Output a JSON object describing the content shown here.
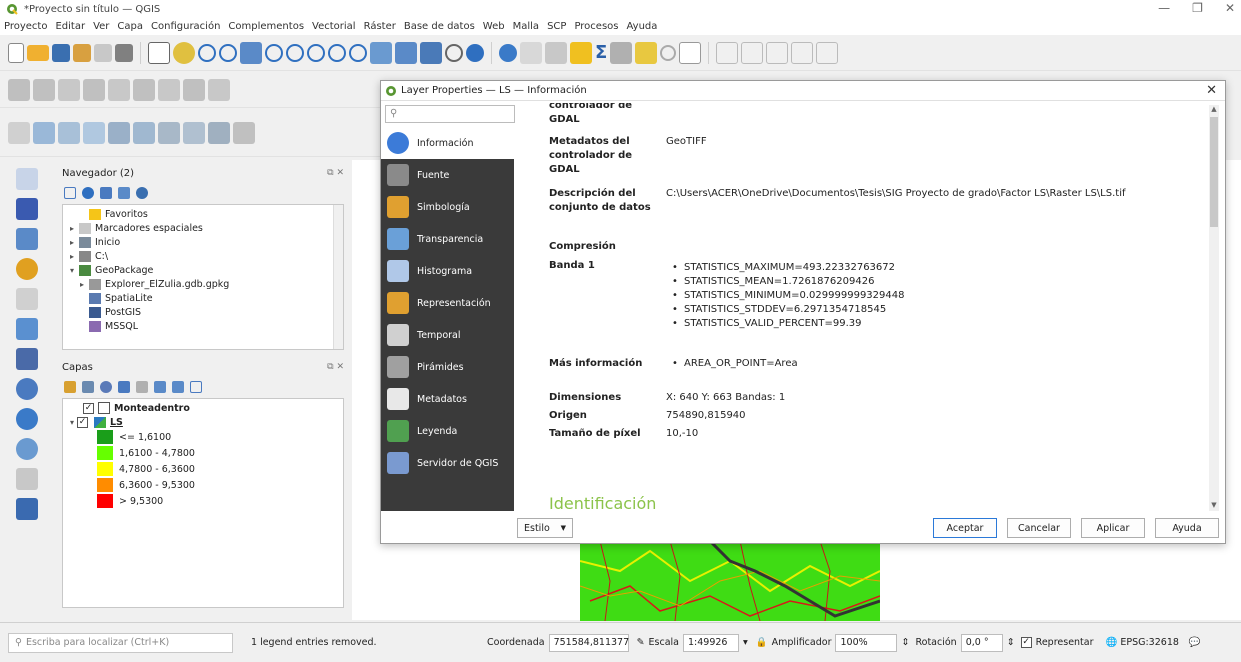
{
  "window": {
    "title": "*Proyecto sin título — QGIS",
    "minimize": "—",
    "maximize": "❐",
    "close": "✕"
  },
  "menu": [
    "Proyecto",
    "Editar",
    "Ver",
    "Capa",
    "Configuración",
    "Complementos",
    "Vectorial",
    "Ráster",
    "Base de datos",
    "Web",
    "Malla",
    "SCP",
    "Procesos",
    "Ayuda"
  ],
  "navigator": {
    "title": "Navegador (2)",
    "items": [
      {
        "label": "Favoritos",
        "icon": "star-icon",
        "arrow": ""
      },
      {
        "label": "Marcadores espaciales",
        "icon": "bookmark-icon",
        "arrow": "▸"
      },
      {
        "label": "Inicio",
        "icon": "home-folder-icon",
        "arrow": "▸"
      },
      {
        "label": "C:\\",
        "icon": "drive-icon",
        "arrow": "▸"
      },
      {
        "label": "GeoPackage",
        "icon": "geopackage-icon",
        "arrow": "▾"
      },
      {
        "label": "Explorer_ElZulia.gdb.gpkg",
        "icon": "database-icon",
        "arrow": "▸"
      },
      {
        "label": "SpatiaLite",
        "icon": "spatialite-icon",
        "arrow": ""
      },
      {
        "label": "PostGIS",
        "icon": "postgis-icon",
        "arrow": ""
      },
      {
        "label": "MSSQL",
        "icon": "mssql-icon",
        "arrow": ""
      }
    ]
  },
  "layers": {
    "title": "Capas",
    "layer1": "Monteadentro",
    "layer2": "LS",
    "legend": [
      {
        "label": "<= 1,6100",
        "color": "#1a9e1a"
      },
      {
        "label": "1,6100 - 4,7800",
        "color": "#66ff00"
      },
      {
        "label": "4,7800 - 6,3600",
        "color": "#ffff00"
      },
      {
        "label": "6,3600 - 9,5300",
        "color": "#ff8c00"
      },
      {
        "label": "> 9,5300",
        "color": "#ff0000"
      }
    ]
  },
  "dialog": {
    "title": "Layer Properties — LS — Información",
    "search_placeholder": "",
    "sidebar": [
      {
        "label": "Información",
        "icon": "info-icon",
        "color": "#3c7bd8"
      },
      {
        "label": "Fuente",
        "icon": "source-icon",
        "color": "#8a8a8a"
      },
      {
        "label": "Simbología",
        "icon": "symbology-icon",
        "color": "#e0a030"
      },
      {
        "label": "Transparencia",
        "icon": "transparency-icon",
        "color": "#6aa0d8"
      },
      {
        "label": "Histograma",
        "icon": "histogram-icon",
        "color": "#b0c8e8"
      },
      {
        "label": "Representación",
        "icon": "rendering-icon",
        "color": "#e0a030"
      },
      {
        "label": "Temporal",
        "icon": "clock-icon",
        "color": "#d0d0d0"
      },
      {
        "label": "Pirámides",
        "icon": "pyramids-icon",
        "color": "#a0a0a0"
      },
      {
        "label": "Metadatos",
        "icon": "metadata-icon",
        "color": "#e8e8e8"
      },
      {
        "label": "Leyenda",
        "icon": "legend-icon",
        "color": "#50a050"
      },
      {
        "label": "Servidor de QGIS",
        "icon": "server-icon",
        "color": "#7a9ad0"
      }
    ],
    "info": {
      "cut_top": "controlador de",
      "gdal1": "GDAL",
      "meta_key": "Metadatos del controlador de GDAL",
      "meta_val": "GeoTIFF",
      "desc_key": "Descripción del conjunto de datos",
      "desc_val": "C:\\Users\\ACER\\OneDrive\\Documentos\\Tesis\\SIG Proyecto de grado\\Factor LS\\Raster LS\\LS.tif",
      "compress_key": "Compresión",
      "band_key": "Banda 1",
      "band_vals": [
        "STATISTICS_MAXIMUM=493.22332763672",
        "STATISTICS_MEAN=1.7261876209426",
        "STATISTICS_MINIMUM=0.029999999329448",
        "STATISTICS_STDDEV=6.2971354718545",
        "STATISTICS_VALID_PERCENT=99.39"
      ],
      "more_key": "Más información",
      "more_val": "AREA_OR_POINT=Area",
      "dim_key": "Dimensiones",
      "dim_val": "X: 640 Y: 663 Bandas: 1",
      "origin_key": "Origen",
      "origin_val": "754890,815940",
      "pixel_key": "Tamaño de píxel",
      "pixel_val": "10,-10",
      "section_partial": "Identificación"
    },
    "estilo": "Estilo",
    "buttons": {
      "ok": "Aceptar",
      "cancel": "Cancelar",
      "apply": "Aplicar",
      "help": "Ayuda"
    }
  },
  "statusbar": {
    "locator_placeholder": "Escriba para localizar (Ctrl+K)",
    "message": "1 legend entries removed.",
    "coord_label": "Coordenada",
    "coord_val": "751584,811377",
    "scale_label": "Escala",
    "scale_val": "1:49926",
    "mag_label": "Amplificador",
    "mag_val": "100%",
    "rot_label": "Rotación",
    "rot_val": "0,0 °",
    "render_label": "Representar",
    "crs": "EPSG:32618"
  }
}
